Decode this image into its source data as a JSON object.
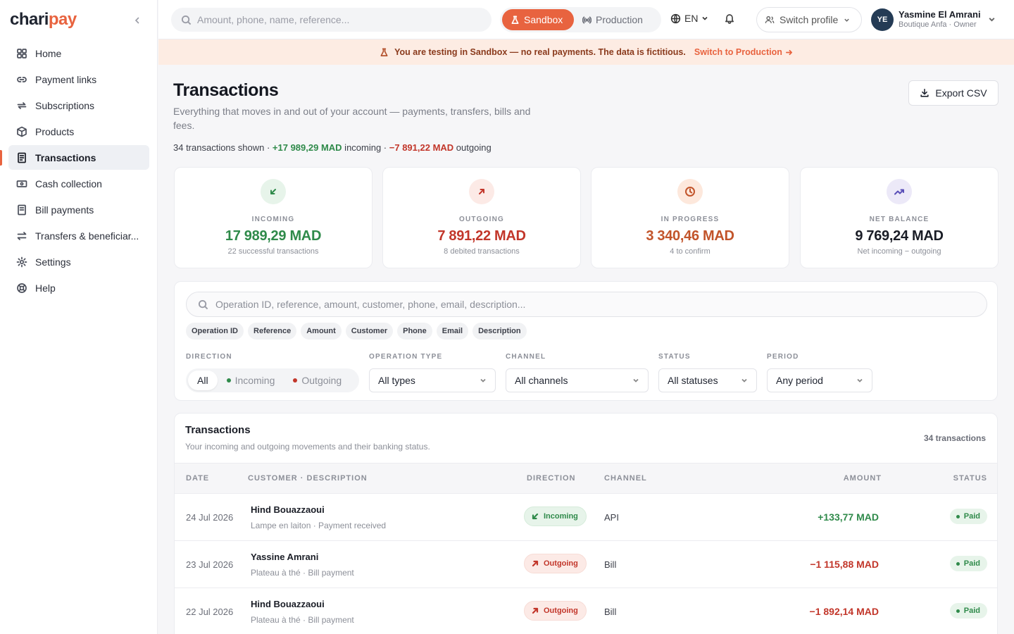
{
  "brand": {
    "name_part1": "chari",
    "name_part2": "pay"
  },
  "sidebar": {
    "items": [
      {
        "label": "Home",
        "icon": "grid-icon"
      },
      {
        "label": "Payment links",
        "icon": "link-icon"
      },
      {
        "label": "Subscriptions",
        "icon": "repeat-icon"
      },
      {
        "label": "Products",
        "icon": "box-icon"
      },
      {
        "label": "Transactions",
        "icon": "receipt-icon",
        "active": true
      },
      {
        "label": "Cash collection",
        "icon": "cash-icon"
      },
      {
        "label": "Bill payments",
        "icon": "bill-icon"
      },
      {
        "label": "Transfers & beneficiar...",
        "icon": "transfer-icon"
      },
      {
        "label": "Settings",
        "icon": "gear-icon"
      },
      {
        "label": "Help",
        "icon": "lifebuoy-icon"
      }
    ]
  },
  "topbar": {
    "search_placeholder": "Amount, phone, name, reference...",
    "env_sandbox": "Sandbox",
    "env_production": "Production",
    "language": "EN",
    "switch_profile": "Switch profile",
    "avatar_initials": "YE",
    "user_name": "Yasmine El Amrani",
    "user_role": "Boutique Anfa · Owner"
  },
  "banner": {
    "message": "You are testing in Sandbox — no real payments. The data is fictitious.",
    "link": "Switch to Production"
  },
  "header": {
    "title": "Transactions",
    "subtitle": "Everything that moves in and out of your account — payments, transfers, bills and fees.",
    "summary_prefix": "34 transactions shown · ",
    "summary_incoming_amount": "+17 989,29 MAD",
    "summary_incoming_label": " incoming · ",
    "summary_outgoing_amount": "−7 891,22 MAD",
    "summary_outgoing_label": " outgoing",
    "export_label": "Export CSV"
  },
  "stats": [
    {
      "label": "INCOMING",
      "value": "17 989,29 MAD",
      "sub": "22 successful transactions",
      "color": "#2f8a4a",
      "bg": "#e7f4ea",
      "icon": "arrow-down-left-icon"
    },
    {
      "label": "OUTGOING",
      "value": "7 891,22 MAD",
      "sub": "8 debited transactions",
      "color": "#c2362a",
      "bg": "#fceae6",
      "icon": "arrow-up-right-icon"
    },
    {
      "label": "IN PROGRESS",
      "value": "3 340,46 MAD",
      "sub": "4 to confirm",
      "color": "#c2542a",
      "bg": "#fde8dc",
      "icon": "clock-icon"
    },
    {
      "label": "NET BALANCE",
      "value": "9 769,24 MAD",
      "sub": "Net incoming − outgoing",
      "color": "#1a1d26",
      "bg": "#ece9f8",
      "icon": "trend-up-icon"
    }
  ],
  "filters": {
    "search_placeholder": "Operation ID, reference, amount, customer, phone, email, description...",
    "chips": [
      "Operation ID",
      "Reference",
      "Amount",
      "Customer",
      "Phone",
      "Email",
      "Description"
    ],
    "direction_label": "DIRECTION",
    "direction_options": [
      "All",
      "Incoming",
      "Outgoing"
    ],
    "type_label": "OPERATION TYPE",
    "type_value": "All types",
    "channel_label": "CHANNEL",
    "channel_value": "All channels",
    "status_label": "STATUS",
    "status_value": "All statuses",
    "period_label": "PERIOD",
    "period_value": "Any period"
  },
  "table": {
    "title": "Transactions",
    "subtitle": "Your incoming and outgoing movements and their banking status.",
    "count": "34 transactions",
    "columns": [
      "DATE",
      "CUSTOMER · DESCRIPTION",
      "DIRECTION",
      "CHANNEL",
      "AMOUNT",
      "STATUS"
    ],
    "rows": [
      {
        "date": "24 Jul 2026",
        "name": "Hind Bouazzaoui",
        "desc": "Lampe en laiton · Payment received",
        "direction": "Incoming",
        "channel": "API",
        "amount": "+133,77 MAD",
        "status": "Paid"
      },
      {
        "date": "23 Jul 2026",
        "name": "Yassine Amrani",
        "desc": "Plateau à thé · Bill payment",
        "direction": "Outgoing",
        "channel": "Bill",
        "amount": "−1 115,88 MAD",
        "status": "Paid"
      },
      {
        "date": "22 Jul 2026",
        "name": "Hind Bouazzaoui",
        "desc": "Plateau à thé · Bill payment",
        "direction": "Outgoing",
        "channel": "Bill",
        "amount": "−1 892,14 MAD",
        "status": "Paid"
      }
    ]
  }
}
